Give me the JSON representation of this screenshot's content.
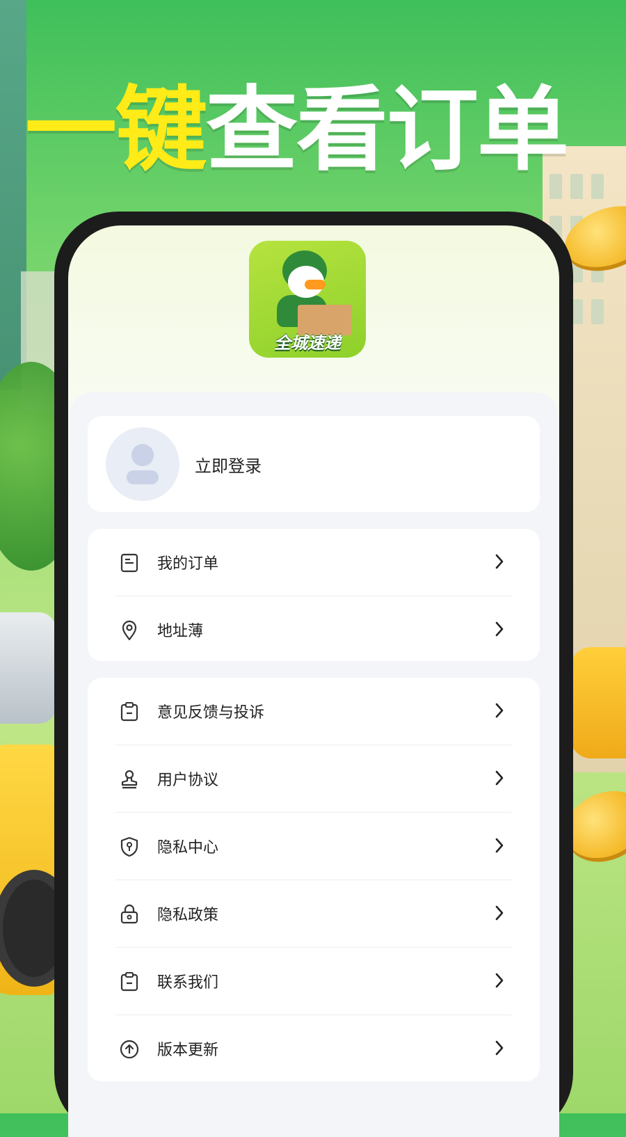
{
  "promo": {
    "headline_highlight": "一键",
    "headline_rest": "查看订单"
  },
  "app": {
    "logo_text": "全城速递"
  },
  "login": {
    "label": "立即登录"
  },
  "menu_group_1": [
    {
      "label": "我的订单",
      "icon": "order-icon"
    },
    {
      "label": "地址薄",
      "icon": "location-pin-icon"
    }
  ],
  "menu_group_2": [
    {
      "label": "意见反馈与投诉",
      "icon": "clipboard-icon"
    },
    {
      "label": "用户协议",
      "icon": "stamp-icon"
    },
    {
      "label": "隐私中心",
      "icon": "shield-key-icon"
    },
    {
      "label": "隐私政策",
      "icon": "lock-icon"
    },
    {
      "label": "联系我们",
      "icon": "clipboard-icon"
    },
    {
      "label": "版本更新",
      "icon": "upload-circle-icon"
    }
  ],
  "colors": {
    "accent_yellow": "#ffeb17",
    "background_green": "#6fd26a",
    "phone_frame": "#1c1c1c"
  }
}
